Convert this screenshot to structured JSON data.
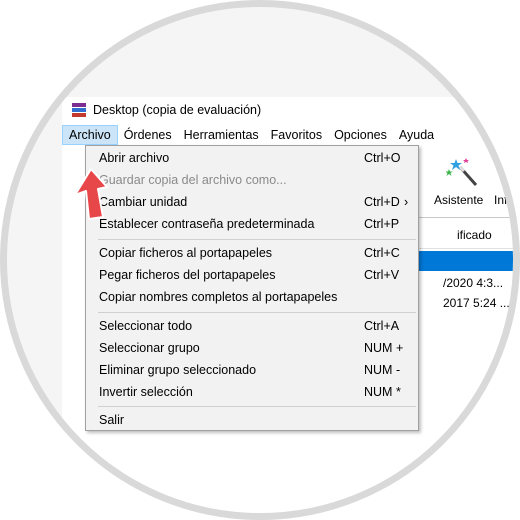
{
  "window": {
    "title": "Desktop (copia de evaluación)"
  },
  "menubar": {
    "items": [
      "Archivo",
      "Órdenes",
      "Herramientas",
      "Favoritos",
      "Opciones",
      "Ayuda"
    ],
    "active_index": 0
  },
  "toolbar": {
    "wizard_label": "Asistente",
    "info_label_partial": "Info"
  },
  "file_list": {
    "column_partial": "ificado",
    "row1_date_partial": "/2020 4:3...",
    "row2_date_partial": "2017 5:24 ..."
  },
  "archivo_menu": {
    "items": [
      {
        "label": "Abrir archivo",
        "shortcut": "Ctrl+O",
        "disabled": false
      },
      {
        "label": "Guardar copia del archivo como...",
        "shortcut": "",
        "disabled": true
      },
      {
        "label": "Cambiar unidad",
        "shortcut": "Ctrl+D",
        "disabled": false,
        "submenu": true
      },
      {
        "label": "Establecer contraseña predeterminada",
        "shortcut": "Ctrl+P",
        "disabled": false
      },
      {
        "label": "Copiar ficheros al portapapeles",
        "shortcut": "Ctrl+C",
        "disabled": false
      },
      {
        "label": "Pegar ficheros del portapapeles",
        "shortcut": "Ctrl+V",
        "disabled": false
      },
      {
        "label": "Copiar nombres completos al portapapeles",
        "shortcut": "",
        "disabled": false
      },
      {
        "label": "Seleccionar todo",
        "shortcut": "Ctrl+A",
        "disabled": false
      },
      {
        "label": "Seleccionar grupo",
        "shortcut": "NUM +",
        "disabled": false
      },
      {
        "label": "Eliminar grupo seleccionado",
        "shortcut": "NUM -",
        "disabled": false
      },
      {
        "label": "Invertir selección",
        "shortcut": "NUM *",
        "disabled": false
      },
      {
        "label": "Salir",
        "shortcut": "",
        "disabled": false
      }
    ],
    "submenu_indicator": "›"
  },
  "colors": {
    "arrow": "#e8474a",
    "menu_active_bg": "#cce4f7",
    "selection": "#0078d7"
  }
}
